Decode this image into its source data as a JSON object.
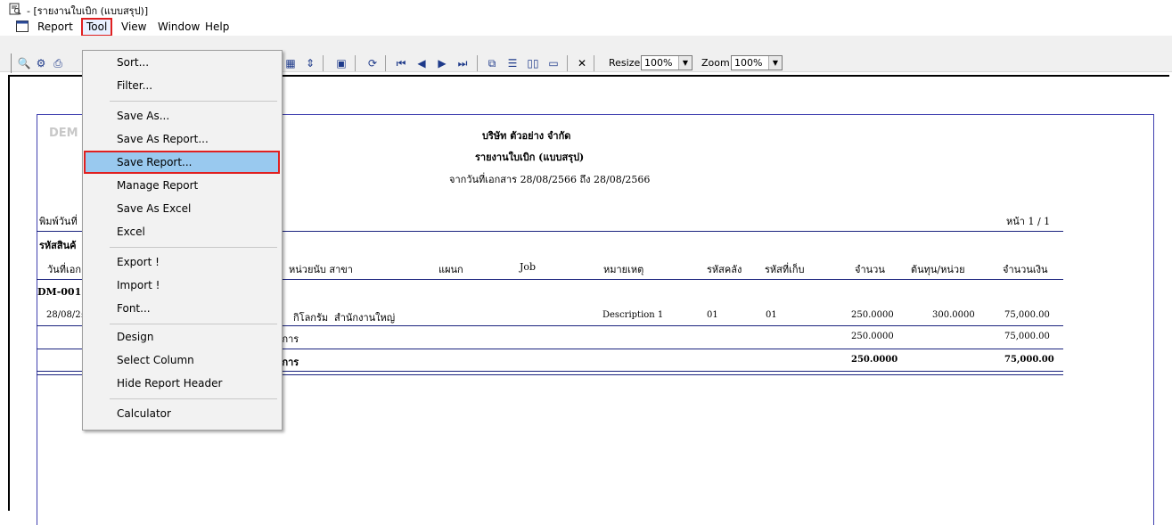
{
  "window": {
    "title": "- [รายงานใบเบิก (แบบสรุป)]"
  },
  "menu": {
    "items": [
      "Report",
      "Tool",
      "View",
      "Window",
      "Help"
    ],
    "active": "Tool"
  },
  "toolbar": {
    "resize_label": "Resize:",
    "resize_value": "100%",
    "zoom_label": "Zoom:",
    "zoom_value": "100%"
  },
  "tool_menu": {
    "items": [
      "Sort...",
      "Filter...",
      "Save As...",
      "Save As Report...",
      "Save Report...",
      "Manage Report",
      "Save As Excel",
      "Excel",
      "Export !",
      "Import !",
      "Font...",
      "Design",
      "Select Column",
      "Hide Report Header",
      "Calculator"
    ],
    "selected": "Save Report..."
  },
  "report": {
    "watermark": "DEM",
    "company": "บริษัท ตัวอย่าง จำกัด",
    "title": "รายงานใบเบิก (แบบสรุป)",
    "date_range_label": "จากวันที่เอกสาร",
    "date_from": "28/08/2566",
    "date_to_label": "ถึง",
    "date_to": "28/08/2566",
    "print_date_label": "พิมพ์วันที่",
    "page_label": "หน้า",
    "page_value": "1 / 1",
    "group_label": "รหัสสินค้",
    "columns": {
      "doc_date": "วันที่เอก",
      "unit_branch": "หน่วยนับ สาขา",
      "department": "แผนก",
      "job": "Job",
      "remark": "หมายเหตุ",
      "warehouse": "รหัสคลัง",
      "location": "รหัสที่เก็บ",
      "qty": "จำนวน",
      "unit_cost": "ต้นทุน/หน่วย",
      "amount": "จำนวนเงิน"
    },
    "group_code": "DM-001",
    "row": {
      "date": "28/08/2:",
      "unit": "กิโลกรัม",
      "branch": "สำนักงานใหญ่",
      "remark": "Description 1",
      "warehouse": "01",
      "location": "01",
      "qty": "250.0000",
      "unit_cost": "300.0000",
      "amount": "75,000.00"
    },
    "subtotal": {
      "label": "ยการ",
      "qty": "250.0000",
      "amount": "75,000.00"
    },
    "grandtotal": {
      "label": "ยการ",
      "qty": "250.0000",
      "amount": "75,000.00"
    }
  }
}
